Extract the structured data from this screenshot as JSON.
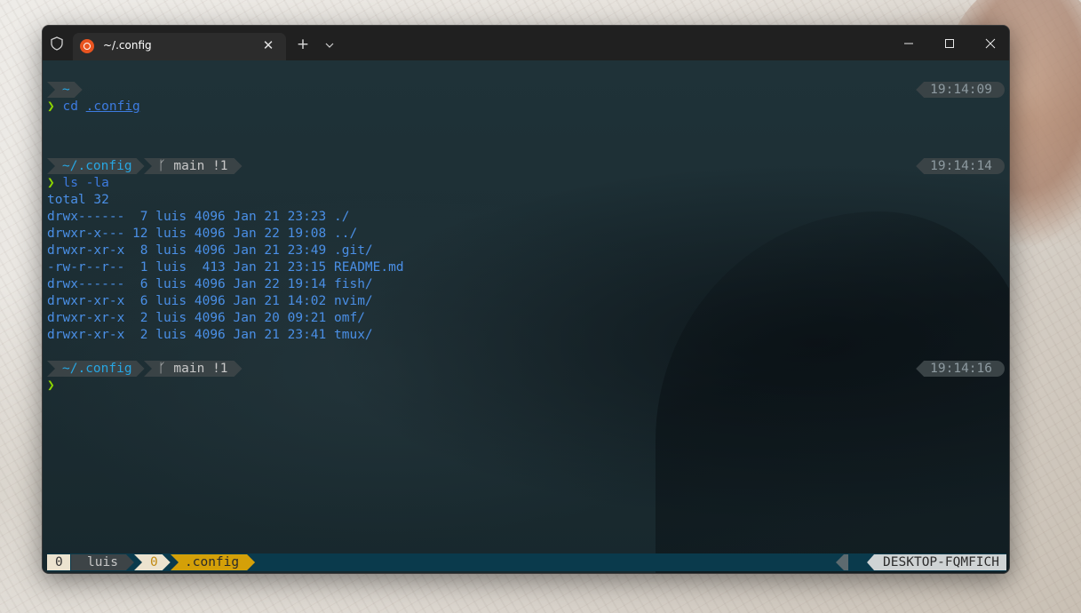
{
  "window": {
    "tab_title": "~/.config",
    "tab_close": "✕",
    "new_tab": "+",
    "minimize": "—",
    "maximize": "☐",
    "close": "✕"
  },
  "colors": {
    "prompt_arrow": "#8cd400",
    "command": "#3d7be0",
    "path_text": "#27a6e2",
    "output": "#4a8fe6",
    "timestamp": "#8d9aa0",
    "status_bg": "#0a3a4c"
  },
  "terminal": {
    "block1": {
      "path": "~",
      "time": "19:14:09",
      "prompt": "❯",
      "command": "cd",
      "argument": ".config"
    },
    "block2": {
      "path": "~/.config",
      "git": " main !1",
      "time": "19:14:14",
      "prompt": "❯",
      "command": "ls -la",
      "output": [
        "total 32",
        "drwx------  7 luis 4096 Jan 21 23:23 ./",
        "drwxr-x--- 12 luis 4096 Jan 22 19:08 ../",
        "drwxr-xr-x  8 luis 4096 Jan 21 23:49 .git/",
        "-rw-r--r--  1 luis  413 Jan 21 23:15 README.md",
        "drwx------  6 luis 4096 Jan 22 19:14 fish/",
        "drwxr-xr-x  6 luis 4096 Jan 21 14:02 nvim/",
        "drwxr-xr-x  2 luis 4096 Jan 20 09:21 omf/",
        "drwxr-xr-x  2 luis 4096 Jan 21 23:41 tmux/"
      ]
    },
    "block3": {
      "path": "~/.config",
      "git": " main !1",
      "time": "19:14:16",
      "prompt": "❯"
    }
  },
  "statusbar": {
    "session_index": "0",
    "session_name": "luis",
    "window_index": "0",
    "window_name": ".config",
    "hostname": "DESKTOP-FQMFICH"
  }
}
